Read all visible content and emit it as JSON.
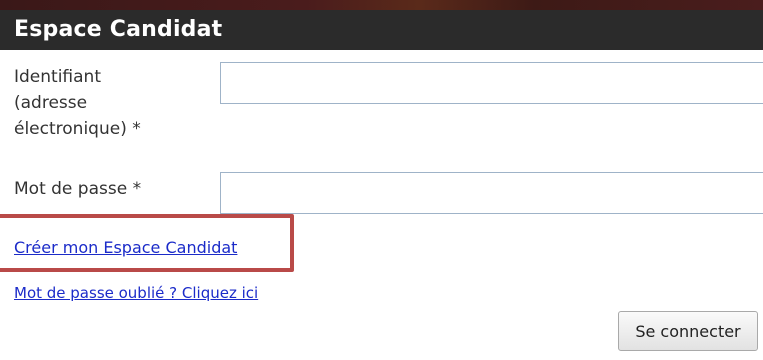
{
  "header": {
    "title": "Espace Candidat"
  },
  "form": {
    "identifiant_label_lines": [
      "Identifiant",
      "(adresse",
      "électronique) *"
    ],
    "identifiant_value": "",
    "password_label": "Mot de passe *",
    "password_value": ""
  },
  "links": {
    "create_account": "Créer mon Espace Candidat",
    "forgot_password": "Mot de passe oublié ? Cliquez ici"
  },
  "actions": {
    "login_label": "Se connecter"
  },
  "colors": {
    "header_bg": "#2b2b2b",
    "link": "#1b2bc9",
    "highlight": "#b94a48"
  }
}
